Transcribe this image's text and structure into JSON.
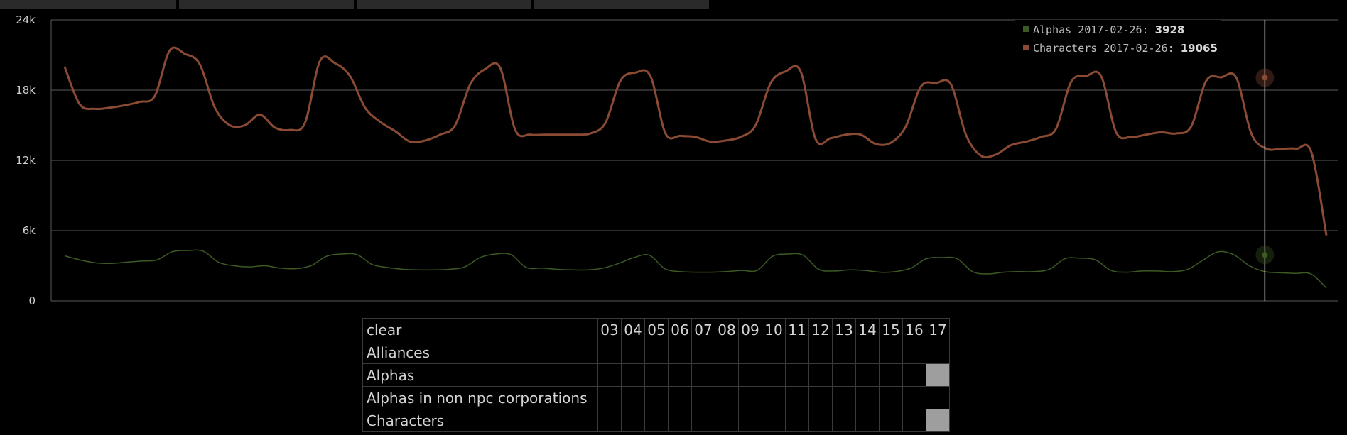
{
  "tabs": [
    "",
    "",
    "",
    ""
  ],
  "chart_data": {
    "type": "line",
    "title": "",
    "xlabel": "",
    "ylabel": "",
    "ylim": [
      0,
      24000
    ],
    "y_ticks": [
      0,
      6000,
      12000,
      18000,
      24000
    ],
    "y_tick_labels": [
      "0",
      "6k",
      "12k",
      "18k",
      "24k"
    ],
    "grid": true,
    "legend_position": "top-right",
    "hover_date": "2017-02-26",
    "series": [
      {
        "name": "Alphas",
        "color": "#3d5a23",
        "hover_value": 3928,
        "values": [
          3850,
          3500,
          3250,
          3200,
          3300,
          3400,
          3500,
          4200,
          4300,
          4250,
          3300,
          3000,
          2900,
          3000,
          2800,
          2750,
          3000,
          3800,
          4000,
          3950,
          3100,
          2850,
          2700,
          2650,
          2650,
          2700,
          2900,
          3700,
          4000,
          3950,
          2850,
          2800,
          2700,
          2650,
          2650,
          2800,
          3200,
          3700,
          3900,
          2750,
          2500,
          2450,
          2450,
          2500,
          2600,
          2600,
          3800,
          4000,
          3900,
          2700,
          2550,
          2650,
          2600,
          2450,
          2500,
          2800,
          3600,
          3700,
          3600,
          2500,
          2300,
          2450,
          2500,
          2500,
          2700,
          3600,
          3650,
          3500,
          2600,
          2450,
          2550,
          2550,
          2500,
          2700,
          3500,
          4200,
          3928,
          3000,
          2500,
          2400,
          2350,
          2300,
          1100
        ]
      },
      {
        "name": "Characters",
        "color": "#8a4a33",
        "hover_value": 19065,
        "values": [
          20000,
          16800,
          16400,
          16500,
          16700,
          17000,
          17500,
          21400,
          21100,
          20200,
          16500,
          15000,
          15000,
          15900,
          14800,
          14600,
          15200,
          20500,
          20300,
          19200,
          16500,
          15300,
          14500,
          13600,
          13700,
          14200,
          15000,
          18500,
          19800,
          19900,
          14600,
          14200,
          14200,
          14200,
          14200,
          14300,
          15200,
          18800,
          19500,
          19200,
          14300,
          14100,
          14000,
          13600,
          13700,
          14000,
          15000,
          18600,
          19600,
          19600,
          13800,
          13900,
          14200,
          14200,
          13400,
          13500,
          14900,
          18300,
          18600,
          18500,
          14200,
          12400,
          12500,
          13300,
          13600,
          14000,
          14700,
          18700,
          19200,
          19200,
          14400,
          14000,
          14200,
          14400,
          14300,
          14900,
          18800,
          19100,
          19065,
          14300,
          13000,
          13000,
          13000,
          12700,
          5600
        ]
      }
    ]
  },
  "legend": {
    "items": [
      {
        "series": "Alphas",
        "date": "2017-02-26",
        "value": "3928",
        "color": "#3d5a23"
      },
      {
        "series": "Characters",
        "date": "2017-02-26",
        "value": "19065",
        "color": "#8a4a33"
      }
    ]
  },
  "selector": {
    "clear_label": "clear",
    "years": [
      "03",
      "04",
      "05",
      "06",
      "07",
      "08",
      "09",
      "10",
      "11",
      "12",
      "13",
      "14",
      "15",
      "16",
      "17"
    ],
    "rows": [
      {
        "label": "Alliances",
        "selected": []
      },
      {
        "label": "Alphas",
        "selected": [
          "17"
        ]
      },
      {
        "label": "Alphas in non npc corporations",
        "selected": []
      },
      {
        "label": "Characters",
        "selected": [
          "17"
        ]
      }
    ]
  }
}
